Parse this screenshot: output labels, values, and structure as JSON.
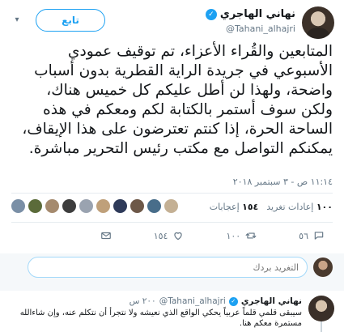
{
  "tweet": {
    "author_name": "نهاني الهاجري",
    "handle": "@Tahani_alhajri",
    "follow_label": "تابع",
    "text": "المتابعين والقُراء الأعزاء، تم توقيف عمودي الأسبوعي في جريدة الراية القطرية بدون أسباب واضحة، ولهذا لن أطل عليكم كل خميس هناك، ولكن سوف أستمر بالكتابة لكم ومعكم في هذه الساحة الحرة، إذا كنتم تعترضون على هذا الإيقاف، يمكنكم التواصل مع مكتب رئيس التحرير مباشرة.",
    "timestamp": "١١:١٤ ص - ٣ سبتمبر ٢٠١٨"
  },
  "stats": {
    "retweets_count": "١٠٠",
    "retweets_label": "إعادات تغريد",
    "likes_count": "١٥٤",
    "likes_label": "إعجابات"
  },
  "actions": {
    "reply_count": "٥٦",
    "retweet_count": "١٠٠",
    "like_count": "١٥٤"
  },
  "reply_box": {
    "placeholder": "التغريد بردك"
  },
  "reply_tweet": {
    "author_name": "نهاني الهاجري",
    "handle": "@Tahani_alhajri",
    "time": "٢٠٠ س",
    "text": "سيبقى قلمي قلماً عربياً يحكي الواقع الذي نعيشه ولا نتجرأ أن نتكلم عنه، وإن شاءالله مستمرة معكم هنا."
  },
  "colors": {
    "accent": "#1da1f2",
    "muted": "#657786",
    "text": "#14171a"
  },
  "icons": [
    "verified-icon",
    "chevron-down-icon",
    "reply-icon",
    "retweet-icon",
    "heart-icon",
    "mail-icon"
  ]
}
